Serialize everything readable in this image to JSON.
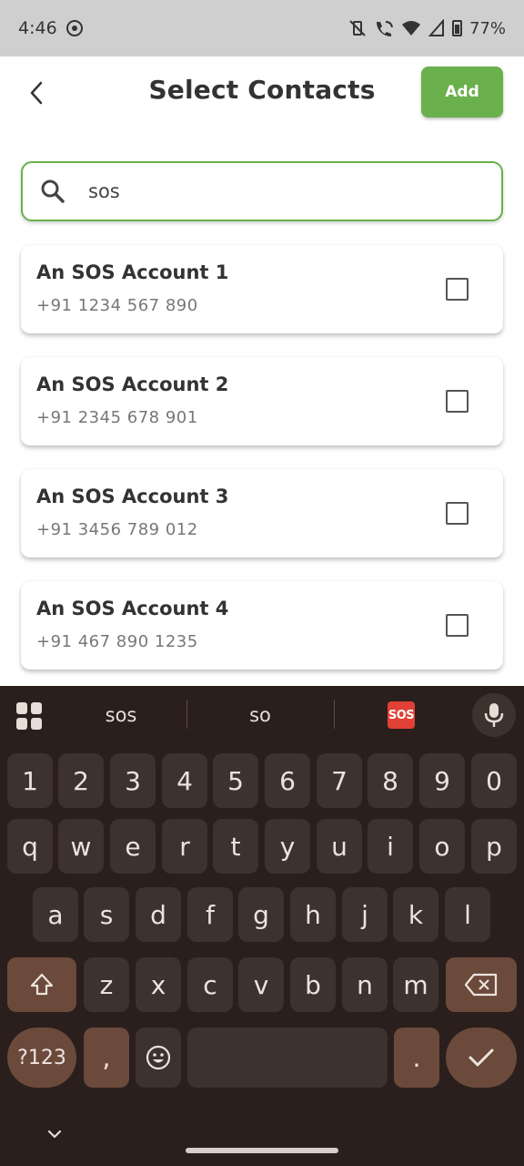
{
  "status_bar": {
    "time": "4:46",
    "battery": "77%"
  },
  "header": {
    "title": "Select Contacts",
    "add_label": "Add"
  },
  "search": {
    "value": "sos"
  },
  "contacts": [
    {
      "name": "An SOS Account 1",
      "phone": "+91 1234 567 890",
      "checked": false
    },
    {
      "name": "An SOS Account 2",
      "phone": "+91 2345 678 901",
      "checked": false
    },
    {
      "name": "An SOS Account 3",
      "phone": "+91 3456 789 012",
      "checked": false
    },
    {
      "name": "An SOS Account 4",
      "phone": "+91 467 890 1235",
      "checked": false
    }
  ],
  "keyboard": {
    "suggestions": [
      "sos",
      "so"
    ],
    "emoji_suggestion": "SOS",
    "row_numbers": [
      "1",
      "2",
      "3",
      "4",
      "5",
      "6",
      "7",
      "8",
      "9",
      "0"
    ],
    "row_top": [
      "q",
      "w",
      "e",
      "r",
      "t",
      "y",
      "u",
      "i",
      "o",
      "p"
    ],
    "row_middle": [
      "a",
      "s",
      "d",
      "f",
      "g",
      "h",
      "j",
      "k",
      "l"
    ],
    "row_bottom": [
      "z",
      "x",
      "c",
      "v",
      "b",
      "n",
      "m"
    ],
    "symbols_label": "?123",
    "comma": ",",
    "period": "."
  },
  "colors": {
    "accent": "#6ab04c",
    "keyboard_bg": "#2a1f1c",
    "key_bg": "#3e322e",
    "func_key_bg": "#6b4a3c"
  }
}
